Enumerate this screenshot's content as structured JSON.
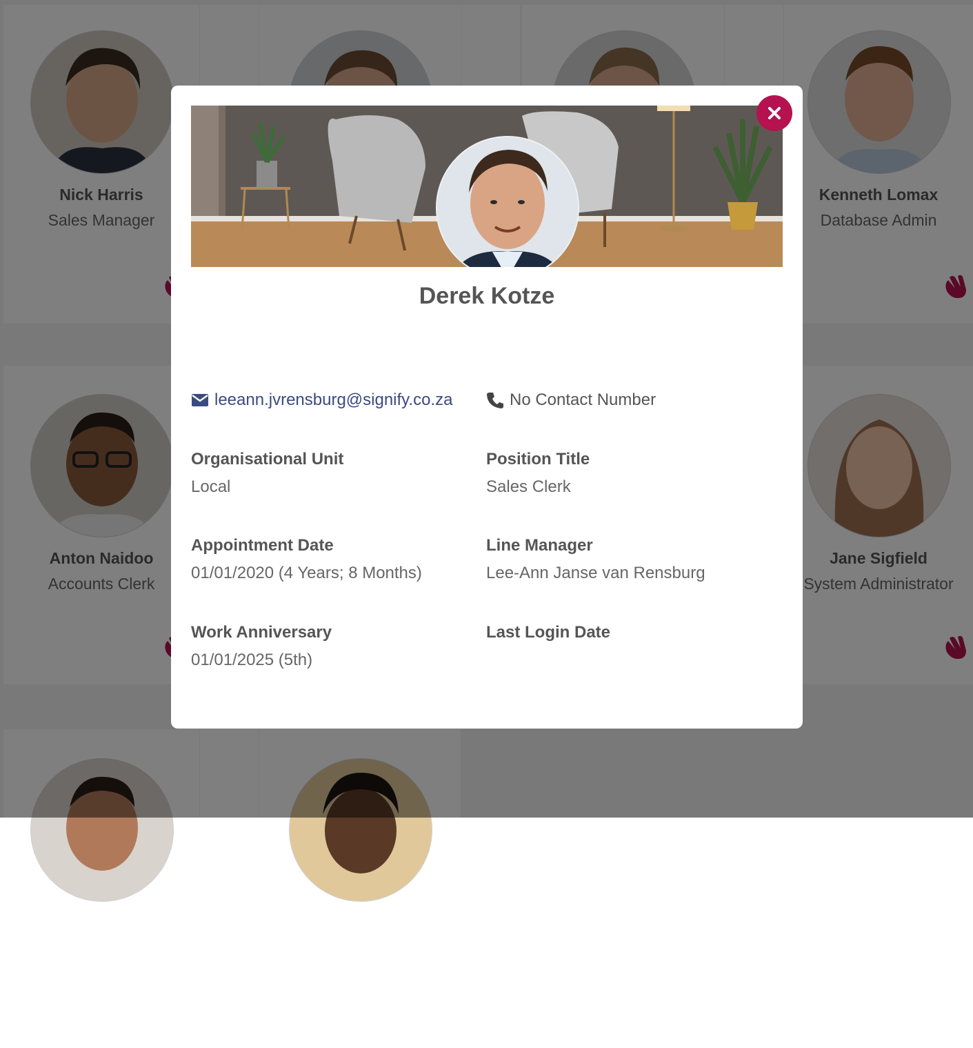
{
  "background_cards": [
    {
      "name": "Nick Harris",
      "title": "Sales Manager"
    },
    {
      "name": "Kenneth Lomax",
      "title": "Database Admin"
    },
    {
      "name": "Anton Naidoo",
      "title": "Accounts Clerk"
    },
    {
      "name": "Jane Sigfield",
      "title": "System Administrator"
    }
  ],
  "modal": {
    "name": "Derek Kotze",
    "email": "leeann.jvrensburg@signify.co.za",
    "phone": "No Contact Number",
    "fields": [
      {
        "label": "Organisational Unit",
        "value": "Local"
      },
      {
        "label": "Position Title",
        "value": "Sales Clerk"
      },
      {
        "label": "Appointment Date",
        "value": "01/01/2020 (4 Years; 8 Months)"
      },
      {
        "label": "Line Manager",
        "value": "Lee-Ann Janse van Rensburg"
      },
      {
        "label": "Work Anniversary",
        "value": "01/01/2025 (5th)"
      },
      {
        "label": "Last Login Date",
        "value": ""
      }
    ]
  },
  "icons": {
    "close": "close-icon",
    "email": "envelope-icon",
    "phone": "phone-icon",
    "wave": "waving-hand-icon"
  },
  "colors": {
    "accent": "#b5124f",
    "link": "#3b4a80",
    "overlay": "rgba(0,0,0,0.5)"
  }
}
